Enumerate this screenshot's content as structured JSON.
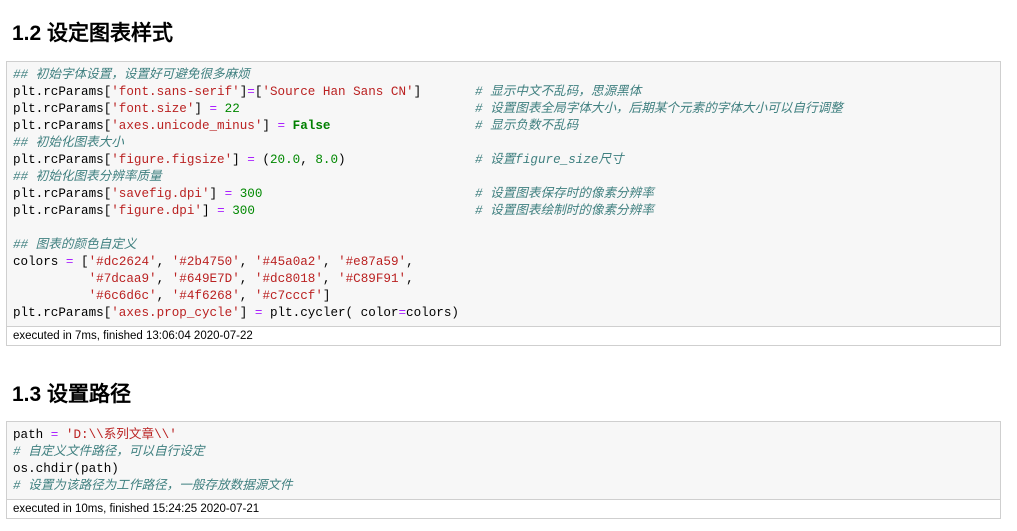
{
  "sections": [
    {
      "heading": "1.2  设定图表样式",
      "lines": [
        {
          "t": [
            [
              "cmt",
              "## 初始字体设置，设置好可避免很多麻烦"
            ]
          ]
        },
        {
          "t": [
            [
              "",
              "plt.rcParams["
            ],
            [
              "str",
              "'font.sans-serif'"
            ],
            [
              "",
              "]"
            ],
            [
              "op",
              "="
            ],
            [
              "",
              "["
            ],
            [
              "str",
              "'Source Han Sans CN'"
            ],
            [
              "",
              "]"
            ]
          ],
          "c": "# 显示中文不乱码，思源黑体"
        },
        {
          "t": [
            [
              "",
              "plt.rcParams["
            ],
            [
              "str",
              "'font.size'"
            ],
            [
              "",
              "] "
            ],
            [
              "op",
              "="
            ],
            [
              "",
              ""
            ],
            [
              "num",
              " 22"
            ]
          ],
          "c": "# 设置图表全局字体大小，后期某个元素的字体大小可以自行调整"
        },
        {
          "t": [
            [
              "",
              "plt.rcParams["
            ],
            [
              "str",
              "'axes.unicode_minus'"
            ],
            [
              "",
              "] "
            ],
            [
              "op",
              "="
            ],
            [
              "kw",
              " False"
            ]
          ],
          "c": "# 显示负数不乱码"
        },
        {
          "t": [
            [
              "cmt",
              "## 初始化图表大小"
            ]
          ]
        },
        {
          "t": [
            [
              "",
              "plt.rcParams["
            ],
            [
              "str",
              "'figure.figsize'"
            ],
            [
              "",
              "] "
            ],
            [
              "op",
              "="
            ],
            [
              "",
              " ("
            ],
            [
              "num",
              "20.0"
            ],
            [
              "",
              ", "
            ],
            [
              "num",
              "8.0"
            ],
            [
              "",
              ")"
            ]
          ],
          "c": "# 设置figure_size尺寸"
        },
        {
          "t": [
            [
              "cmt",
              "## 初始化图表分辨率质量"
            ]
          ]
        },
        {
          "t": [
            [
              "",
              "plt.rcParams["
            ],
            [
              "str",
              "'savefig.dpi'"
            ],
            [
              "",
              "] "
            ],
            [
              "op",
              "="
            ],
            [
              "num",
              " 300"
            ]
          ],
          "c": "# 设置图表保存时的像素分辨率"
        },
        {
          "t": [
            [
              "",
              "plt.rcParams["
            ],
            [
              "str",
              "'figure.dpi'"
            ],
            [
              "",
              "] "
            ],
            [
              "op",
              "="
            ],
            [
              "num",
              " 300"
            ]
          ],
          "c": "# 设置图表绘制时的像素分辨率"
        },
        {
          "t": []
        },
        {
          "t": [
            [
              "cmt",
              "## 图表的颜色自定义"
            ]
          ]
        },
        {
          "t": [
            [
              "",
              "colors "
            ],
            [
              "op",
              "="
            ],
            [
              "",
              " ["
            ],
            [
              "str",
              "'#dc2624'"
            ],
            [
              "",
              ", "
            ],
            [
              "str",
              "'#2b4750'"
            ],
            [
              "",
              ", "
            ],
            [
              "str",
              "'#45a0a2'"
            ],
            [
              "",
              ", "
            ],
            [
              "str",
              "'#e87a59'"
            ],
            [
              "",
              ","
            ]
          ]
        },
        {
          "t": [
            [
              "",
              "          "
            ],
            [
              "str",
              "'#7dcaa9'"
            ],
            [
              "",
              ", "
            ],
            [
              "str",
              "'#649E7D'"
            ],
            [
              "",
              ", "
            ],
            [
              "str",
              "'#dc8018'"
            ],
            [
              "",
              ", "
            ],
            [
              "str",
              "'#C89F91'"
            ],
            [
              "",
              ","
            ]
          ]
        },
        {
          "t": [
            [
              "",
              "          "
            ],
            [
              "str",
              "'#6c6d6c'"
            ],
            [
              "",
              ", "
            ],
            [
              "str",
              "'#4f6268'"
            ],
            [
              "",
              ", "
            ],
            [
              "str",
              "'#c7cccf'"
            ],
            [
              "",
              "]"
            ]
          ]
        },
        {
          "t": [
            [
              "",
              "plt.rcParams["
            ],
            [
              "str",
              "'axes.prop_cycle'"
            ],
            [
              "",
              "] "
            ],
            [
              "op",
              "="
            ],
            [
              "",
              " plt.cycler( color"
            ],
            [
              "op",
              "="
            ],
            [
              "",
              "colors)"
            ]
          ]
        }
      ],
      "output": "executed in 7ms, finished 13:06:04 2020-07-22"
    },
    {
      "heading": "1.3  设置路径",
      "lines": [
        {
          "t": [
            [
              "",
              "path "
            ],
            [
              "op",
              "="
            ],
            [
              "str",
              " 'D:\\\\系列文章\\\\'"
            ]
          ]
        },
        {
          "t": [
            [
              "cmt",
              "# 自定义文件路径，可以自行设定"
            ]
          ]
        },
        {
          "t": [
            [
              "",
              "os.chdir(path)"
            ]
          ]
        },
        {
          "t": [
            [
              "cmt",
              "# 设置为该路径为工作路径，一般存放数据源文件"
            ]
          ]
        }
      ],
      "output": "executed in 10ms, finished 15:24:25 2020-07-21"
    }
  ]
}
